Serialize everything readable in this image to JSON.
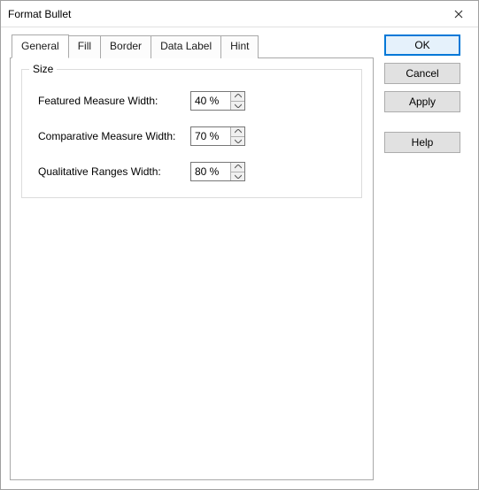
{
  "window": {
    "title": "Format Bullet"
  },
  "tabs": {
    "general": "General",
    "fill": "Fill",
    "border": "Border",
    "dataLabel": "Data Label",
    "hint": "Hint"
  },
  "size": {
    "group_title": "Size",
    "featured_label": "Featured Measure Width:",
    "featured_value": "40 %",
    "comparative_label": "Comparative Measure Width:",
    "comparative_value": "70 %",
    "qualitative_label": "Qualitative Ranges Width:",
    "qualitative_value": "80 %"
  },
  "buttons": {
    "ok": "OK",
    "cancel": "Cancel",
    "apply": "Apply",
    "help": "Help"
  }
}
